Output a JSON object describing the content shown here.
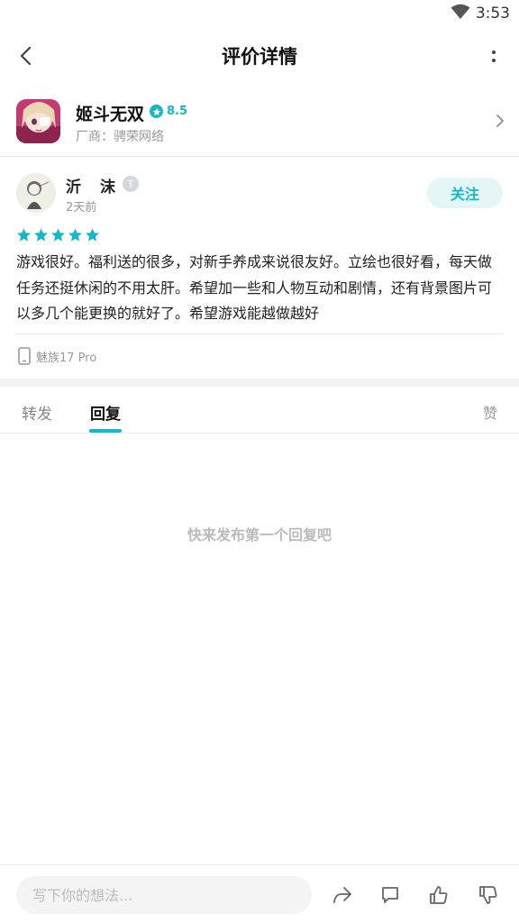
{
  "status_bar": {
    "time": "3:53"
  },
  "header": {
    "title": "评价详情"
  },
  "game": {
    "name": "姬斗无双",
    "score": "8.5",
    "vendor": "厂商：骋荣网络"
  },
  "review": {
    "user_name": "沂　沫",
    "level_badge": "T",
    "time": "2天前",
    "follow_label": "关注",
    "stars": 5,
    "text": "游戏很好。福利送的很多，对新手养成来说很友好。立绘也很好看，每天做任务还挺休闲的不用太肝。希望加一些和人物互动和剧情，还有背景图片可以多几个能更换的就好了。希望游戏能越做越好",
    "device": "魅族17 Pro"
  },
  "tabs": {
    "repost": "转发",
    "reply": "回复",
    "like": "赞"
  },
  "empty_hint": "快来发布第一个回复吧",
  "bottom_bar": {
    "placeholder": "写下你的想法..."
  },
  "colors": {
    "accent": "#14b9c8",
    "follow_bg": "#e5f6f7"
  }
}
